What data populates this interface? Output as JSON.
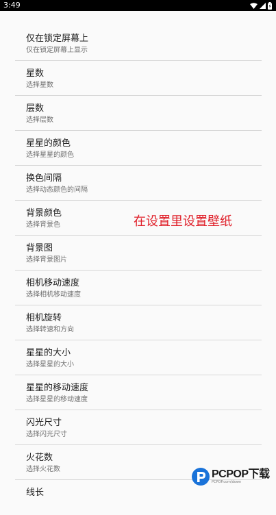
{
  "status_bar": {
    "time": "3:49"
  },
  "settings": [
    {
      "title": "仅在锁定屏幕上",
      "summary": "仅在锁定屏幕上显示"
    },
    {
      "title": "星数",
      "summary": "选择星数"
    },
    {
      "title": "层数",
      "summary": "选择层数"
    },
    {
      "title": "星星的颜色",
      "summary": "选择星星的颜色"
    },
    {
      "title": "换色间隔",
      "summary": "选择动态颜色的间隔"
    },
    {
      "title": "背景颜色",
      "summary": "选择背景色"
    },
    {
      "title": "背景图",
      "summary": "选择背景图片"
    },
    {
      "title": "相机移动速度",
      "summary": "选择相机移动速度"
    },
    {
      "title": "相机旋转",
      "summary": "选择转速和方向"
    },
    {
      "title": "星星的大小",
      "summary": "选择星星的大小"
    },
    {
      "title": "星星的移动速度",
      "summary": "选择星星的移动速度"
    },
    {
      "title": "闪光尺寸",
      "summary": "选择闪光尺寸"
    },
    {
      "title": "火花数",
      "summary": "选择火花数"
    },
    {
      "title": "线长",
      "summary": ""
    }
  ],
  "overlay": {
    "caption": "在设置里设置壁纸"
  },
  "watermark": {
    "brand": "PCPOP下载",
    "url": "PCPOP.com/down"
  },
  "colors": {
    "status_bar": "#000000",
    "background": "#fafafa",
    "divider": "#d6d6d6",
    "overlay_text": "#e0202a",
    "watermark_accent": "#1a73d9"
  },
  "icons": {
    "status": [
      "wifi-icon",
      "signal-icon",
      "battery-icon"
    ]
  }
}
